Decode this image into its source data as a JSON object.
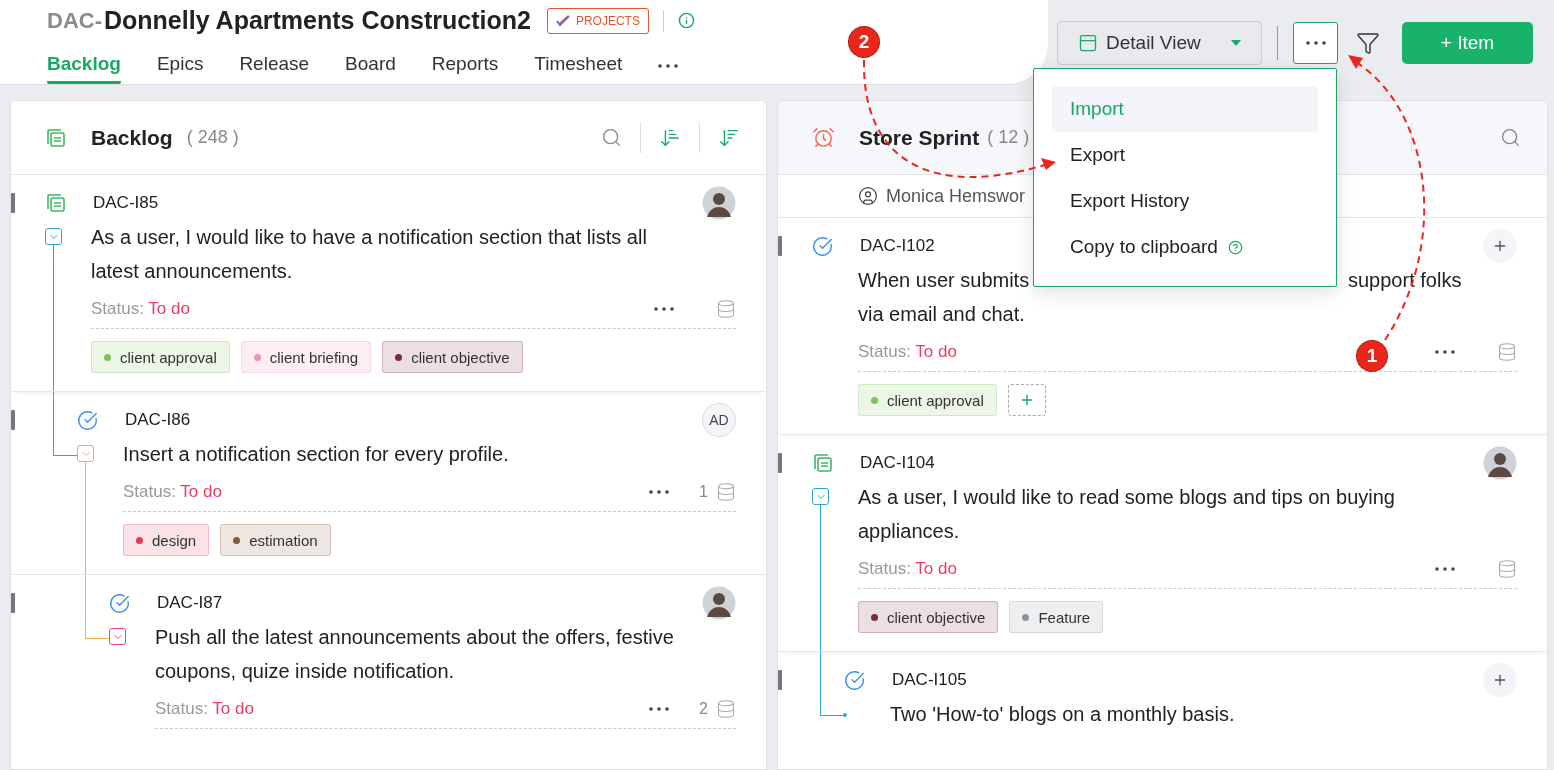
{
  "project": {
    "prefix": "DAC-",
    "name": "Donnelly Apartments Construction2",
    "badge": "PROJECTS"
  },
  "tabs": [
    {
      "label": "Backlog",
      "selected": true
    },
    {
      "label": "Epics",
      "selected": false
    },
    {
      "label": "Release",
      "selected": false
    },
    {
      "label": "Board",
      "selected": false
    },
    {
      "label": "Reports",
      "selected": false
    },
    {
      "label": "Timesheet",
      "selected": false
    }
  ],
  "toolbar": {
    "view_button": "Detail View",
    "more_active": true,
    "add_button": "+ Item"
  },
  "menu": {
    "items": [
      {
        "label": "Import",
        "selected": true
      },
      {
        "label": "Export",
        "selected": false
      },
      {
        "label": "Export History",
        "selected": false
      },
      {
        "label": "Copy to clipboard",
        "selected": false,
        "help": true
      }
    ]
  },
  "backlog": {
    "title": "Backlog",
    "count": "( 248 )",
    "items": [
      {
        "id": "DAC-I85",
        "kind": "story",
        "description": "As a user, I would like to have a notification section that lists all latest announcements.",
        "status_label": "Status:",
        "status": "To do",
        "avatar": {
          "kind": "photo"
        },
        "expanded": true,
        "tags": [
          {
            "label": "client approval",
            "color": "#7cc45a"
          },
          {
            "label": "client briefing",
            "color": "#f28db3"
          },
          {
            "label": "client objective",
            "color": "#7b2a3f"
          }
        ],
        "children": [
          {
            "id": "DAC-I86",
            "kind": "task",
            "description": "Insert a notification section for every profile.",
            "status_label": "Status:",
            "status": "To do",
            "count": "1",
            "avatar": {
              "kind": "initials",
              "text": "AD"
            },
            "expanded": true,
            "tags": [
              {
                "label": "design",
                "color": "#e63a5c"
              },
              {
                "label": "estimation",
                "color": "#8a5a36"
              }
            ],
            "children": [
              {
                "id": "DAC-I87",
                "kind": "task",
                "description": "Push all the latest announcements about the offers, festive coupons, quize inside notification.",
                "status_label": "Status:",
                "status": "To do",
                "count": "2",
                "avatar": {
                  "kind": "photo"
                },
                "expanded": true
              }
            ]
          }
        ]
      }
    ]
  },
  "sprint": {
    "title": "Store Sprint",
    "count": "( 12 )",
    "owner": "Monica Hemswor",
    "items": [
      {
        "id": "DAC-I102",
        "kind": "task",
        "description": "When user submits",
        "description_after": "support folks",
        "description_line2": "via email and chat.",
        "status_label": "Status:",
        "status": "To do",
        "avatar": {
          "kind": "add"
        },
        "add_tag": true,
        "tags": [
          {
            "label": "client approval",
            "color": "#7cc45a"
          }
        ]
      },
      {
        "id": "DAC-I104",
        "kind": "story",
        "description": "As a user, I would like to read some blogs and tips on buying appliances.",
        "status_label": "Status:",
        "status": "To do",
        "avatar": {
          "kind": "photo"
        },
        "expanded": true,
        "tags": [
          {
            "label": "client objective",
            "color": "#7b2a3f"
          },
          {
            "label": "Feature",
            "color": "#8d9299"
          }
        ],
        "children": [
          {
            "id": "DAC-I105",
            "kind": "task",
            "description": "Two 'How-to' blogs on a monthly basis.",
            "avatar": {
              "kind": "add"
            }
          }
        ]
      }
    ]
  },
  "annotations": [
    {
      "label": "2"
    },
    {
      "label": "1"
    }
  ]
}
